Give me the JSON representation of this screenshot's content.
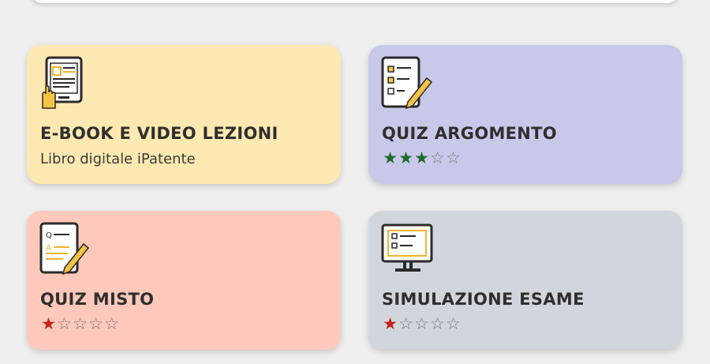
{
  "cards": [
    {
      "title": "E-BOOK E VIDEO LEZIONI",
      "subtitle": "Libro digitale iPatente",
      "icon": "ebook-tablet-icon"
    },
    {
      "title": "QUIZ ARGOMENTO",
      "rating": 3,
      "max_rating": 5,
      "star_color": "#1e6b2b",
      "icon": "checklist-pencil-icon"
    },
    {
      "title": "QUIZ MISTO",
      "rating": 1,
      "max_rating": 5,
      "star_color": "#c8211e",
      "icon": "quiz-qa-pencil-icon"
    },
    {
      "title": "SIMULAZIONE ESAME",
      "rating": 1,
      "max_rating": 5,
      "star_color": "#c8211e",
      "icon": "monitor-checklist-icon"
    }
  ]
}
